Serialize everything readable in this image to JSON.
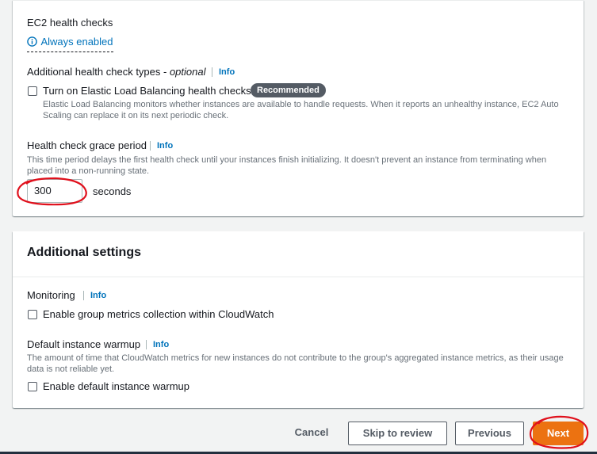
{
  "health_checks": {
    "ec2_title": "EC2 health checks",
    "ec2_status": "Always enabled",
    "additional_types_label": "Additional health check types -",
    "additional_types_optional": "optional",
    "info": "Info",
    "elb_checkbox_label": "Turn on Elastic Load Balancing health checks",
    "elb_badge": "Recommended",
    "elb_desc_line1": "Elastic Load Balancing monitors whether instances are available to handle requests. When it reports an unhealthy instance, EC2 Auto",
    "elb_desc_line2": "Scaling can replace it on its next periodic check.",
    "elb_checked": false,
    "grace_label": "Health check grace period",
    "grace_desc_line1": "This time period delays the first health check until your instances finish initializing. It doesn't prevent an instance from terminating when",
    "grace_desc_line2": "placed into a non-running state.",
    "grace_value": "300",
    "grace_unit": "seconds"
  },
  "additional_settings": {
    "title": "Additional settings",
    "monitoring_label": "Monitoring",
    "info": "Info",
    "metrics_checkbox_label": "Enable group metrics collection within CloudWatch",
    "metrics_checked": false,
    "warmup_label": "Default instance warmup",
    "warmup_desc_line1": "The amount of time that CloudWatch metrics for new instances do not contribute to the group's aggregated instance metrics, as their usage",
    "warmup_desc_line2": "data is not reliable yet.",
    "warmup_checkbox_label": "Enable default instance warmup",
    "warmup_checked": false
  },
  "footer": {
    "cancel": "Cancel",
    "skip": "Skip to review",
    "previous": "Previous",
    "next": "Next"
  },
  "colors": {
    "primary_button": "#ec7211",
    "link": "#0073bb",
    "annotation": "#e0101c"
  }
}
